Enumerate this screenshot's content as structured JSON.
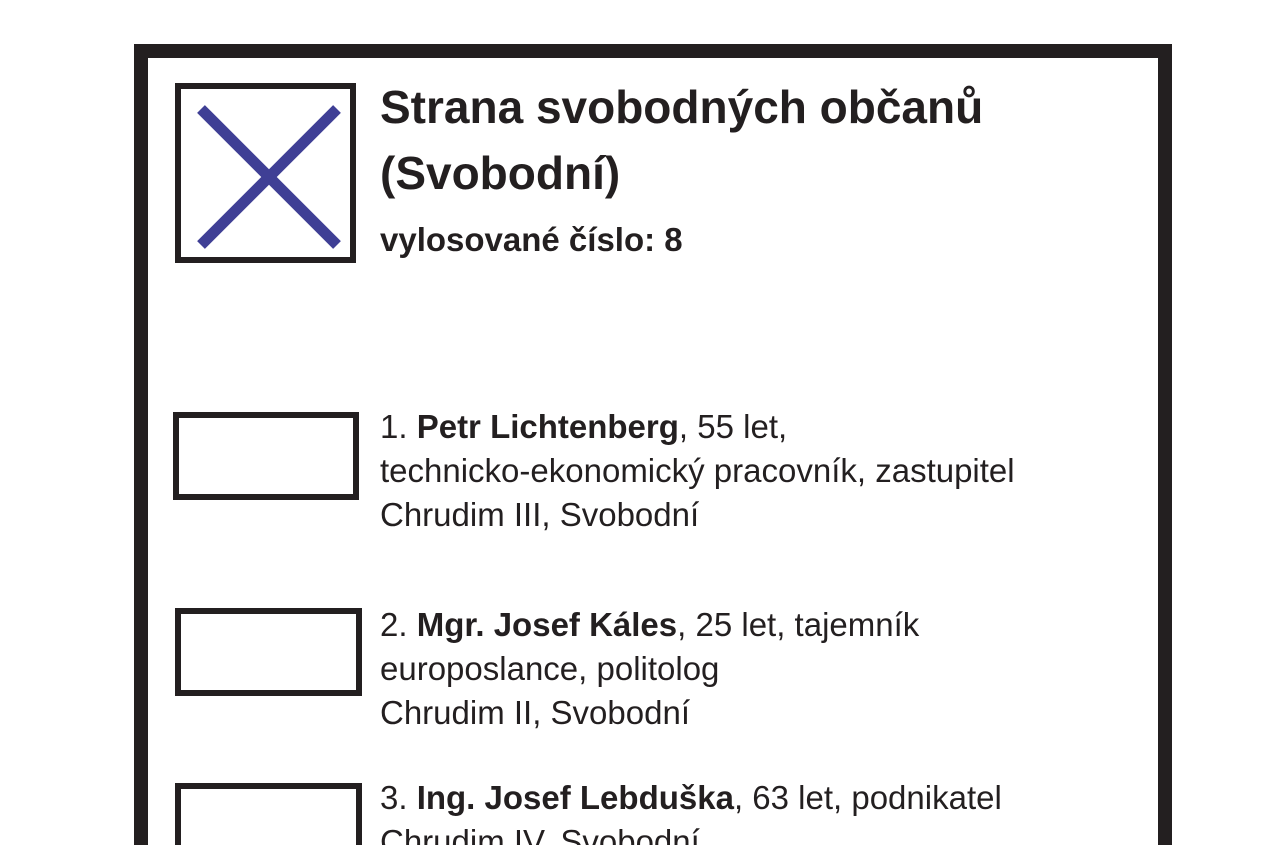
{
  "party": {
    "name_line1": "Strana svobodných občanů",
    "name_line2": "(Svobodní)",
    "lot_number": "vylosované číslo: 8",
    "mark_color": "#3f3f95",
    "mark_icon": "cross-mark-icon"
  },
  "candidates": [
    {
      "number": "1.",
      "name": "Petr Lichtenberg",
      "after_name": ", 55 let,",
      "line2": "technicko-ekonomický pracovník, zastupitel",
      "line3": "Chrudim III, Svobodní"
    },
    {
      "number": "2.",
      "name": "Mgr. Josef Káles",
      "after_name": ", 25 let, tajemník",
      "line2": "europoslance, politolog",
      "line3": "Chrudim II, Svobodní"
    },
    {
      "number": "3.",
      "name": "Ing. Josef Lebduška",
      "after_name": ", 63 let, podnikatel",
      "line2": "Chrudim IV, Svobodní",
      "line3": ""
    }
  ]
}
